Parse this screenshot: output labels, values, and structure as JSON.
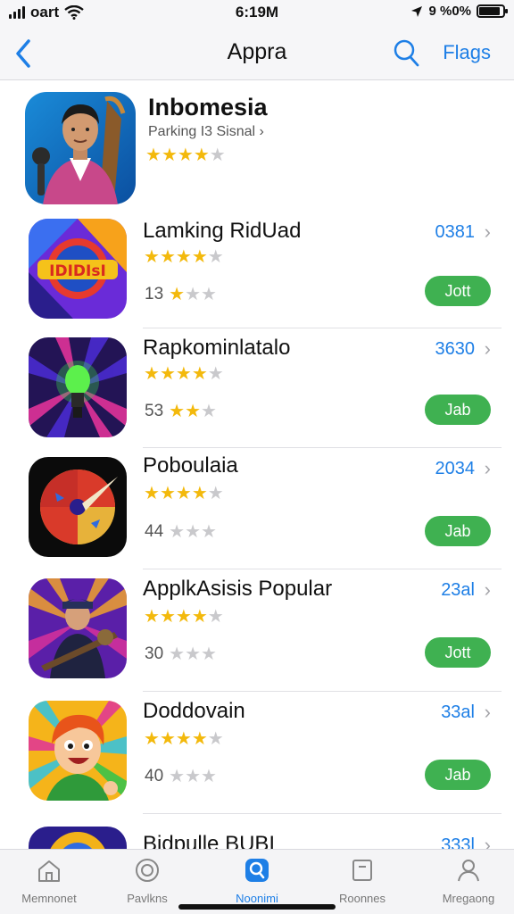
{
  "status_bar": {
    "carrier": "oart",
    "time": "6:19M",
    "battery_text": "9 %0%",
    "battery_level": 0.9
  },
  "nav": {
    "back_icon": "chevron-left-icon",
    "title": "Appra",
    "search_icon": "search-icon",
    "right_label": "Flags"
  },
  "featured": {
    "name": "Inbomesia",
    "subtitle": "Parking I3 Sisnal ›",
    "rating": 4
  },
  "apps": [
    {
      "name": "Lamking RidUad",
      "price": "0381",
      "rating": 4,
      "count": "13",
      "small_rating": 1,
      "button": "Jott"
    },
    {
      "name": "Rapkominlatalo",
      "price": "3630",
      "rating": 4,
      "count": "53",
      "small_rating": 2,
      "button": "Jab"
    },
    {
      "name": "Poboulaia",
      "price": "2034",
      "rating": 4,
      "count": "44",
      "small_rating": 0,
      "button": "Jab"
    },
    {
      "name": "ApplkAsisis Popular",
      "price": "23al",
      "rating": 4,
      "count": "30",
      "small_rating": 0,
      "button": "Jott"
    },
    {
      "name": "Doddovain",
      "price": "33al",
      "rating": 4,
      "count": "40",
      "small_rating": 0,
      "button": "Jab"
    },
    {
      "name": "Bidpulle BUBI",
      "price": "333l"
    }
  ],
  "tabs": [
    {
      "label": "Memnonet",
      "icon": "home-icon",
      "active": false
    },
    {
      "label": "Pavlkns",
      "icon": "badge-icon",
      "active": false
    },
    {
      "label": "Noonimi",
      "icon": "search-icon",
      "active": true
    },
    {
      "label": "Roonnes",
      "icon": "square-icon",
      "active": false
    },
    {
      "label": "Mregaong",
      "icon": "person-icon",
      "active": false
    }
  ],
  "colors": {
    "accent": "#1e7fe6",
    "get_button": "#3fb151",
    "star": "#f3b90c"
  }
}
